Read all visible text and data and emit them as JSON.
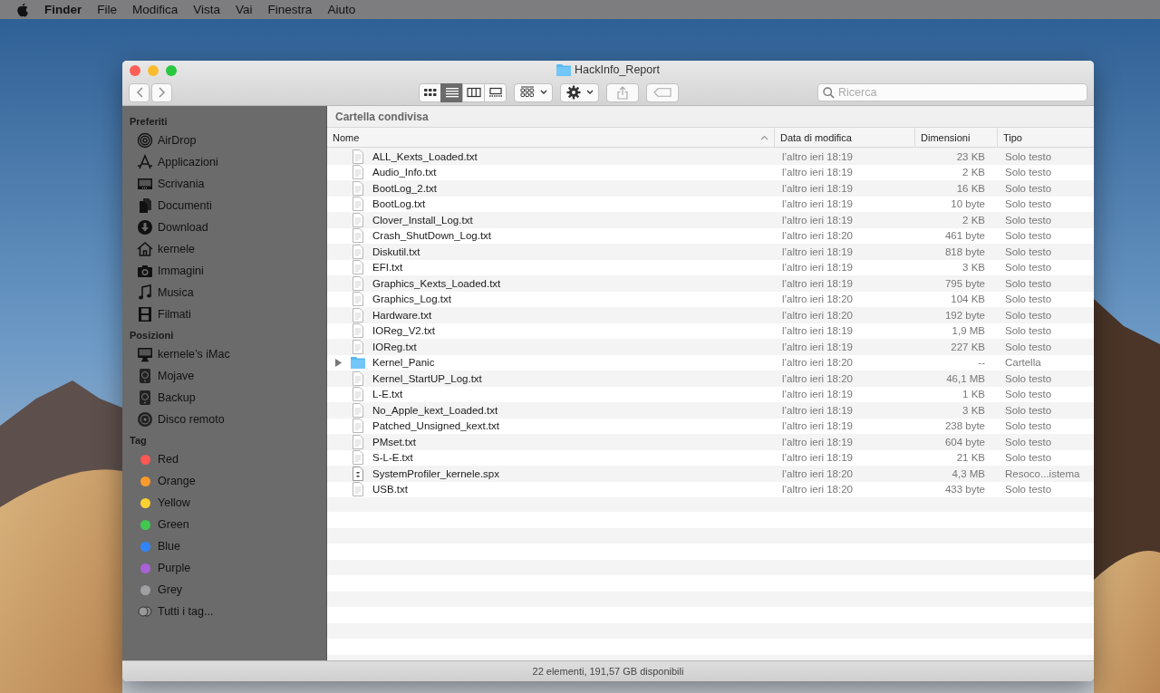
{
  "menu_bar": {
    "items": [
      {
        "label": "Finder",
        "kind": "app"
      },
      {
        "label": "File",
        "kind": "menu"
      },
      {
        "label": "Modifica",
        "kind": "menu"
      },
      {
        "label": "Vista",
        "kind": "menu"
      },
      {
        "label": "Vai",
        "kind": "menu"
      },
      {
        "label": "Finestra",
        "kind": "menu"
      },
      {
        "label": "Aiuto",
        "kind": "menu"
      }
    ]
  },
  "window": {
    "title": "HackInfo_Report"
  },
  "toolbar": {
    "view_buttons": [
      {
        "selected": false
      },
      {
        "selected": true
      },
      {
        "selected": false
      },
      {
        "selected": false
      }
    ],
    "search": {
      "placeholder": "Ricerca"
    }
  },
  "path_bar": "Cartella condivisa",
  "sidebar": {
    "sections": [
      {
        "title": "Preferiti",
        "items": [
          {
            "label": "AirDrop",
            "kind": "place"
          },
          {
            "label": "Applicazioni",
            "kind": "place"
          },
          {
            "label": "Scrivania",
            "kind": "place"
          },
          {
            "label": "Documenti",
            "kind": "place"
          },
          {
            "label": "Download",
            "kind": "place"
          },
          {
            "label": "kernele",
            "kind": "place"
          },
          {
            "label": "Immagini",
            "kind": "place"
          },
          {
            "label": "Musica",
            "kind": "place"
          },
          {
            "label": "Filmati",
            "kind": "place"
          }
        ]
      },
      {
        "title": "Posizioni",
        "items": [
          {
            "label": "kernele’s iMac",
            "kind": "place"
          },
          {
            "label": "Mojave",
            "kind": "place"
          },
          {
            "label": "Backup",
            "kind": "place"
          },
          {
            "label": "Disco remoto",
            "kind": "place"
          }
        ]
      },
      {
        "title": "Tag",
        "items": [
          {
            "label": "Red",
            "kind": "tag",
            "color": "#fc5753"
          },
          {
            "label": "Orange",
            "kind": "tag",
            "color": "#fd9a2d"
          },
          {
            "label": "Yellow",
            "kind": "tag",
            "color": "#fdd130"
          },
          {
            "label": "Green",
            "kind": "tag",
            "color": "#3fc94f"
          },
          {
            "label": "Blue",
            "kind": "tag",
            "color": "#2f85fc"
          },
          {
            "label": "Purple",
            "kind": "tag",
            "color": "#a961d6"
          },
          {
            "label": "Grey",
            "kind": "tag",
            "color": "#a0a0a4"
          },
          {
            "label": "Tutti i tag...",
            "kind": "all-tags"
          }
        ]
      }
    ]
  },
  "table": {
    "columns": [
      {
        "label": "Nome",
        "sorted": true
      },
      {
        "label": "Data di modifica",
        "sorted": false
      },
      {
        "label": "Dimensioni",
        "sorted": false
      },
      {
        "label": "Tipo",
        "sorted": false
      }
    ],
    "rows": [
      {
        "name": "ALL_Kexts_Loaded.txt",
        "date": "l’altro ieri 18:19",
        "size": "23 KB",
        "type": "Solo testo",
        "kind": "text"
      },
      {
        "name": "Audio_Info.txt",
        "date": "l’altro ieri 18:19",
        "size": "2 KB",
        "type": "Solo testo",
        "kind": "text"
      },
      {
        "name": "BootLog_2.txt",
        "date": "l’altro ieri 18:19",
        "size": "16 KB",
        "type": "Solo testo",
        "kind": "text"
      },
      {
        "name": "BootLog.txt",
        "date": "l’altro ieri 18:19",
        "size": "10 byte",
        "type": "Solo testo",
        "kind": "text"
      },
      {
        "name": "Clover_Install_Log.txt",
        "date": "l’altro ieri 18:19",
        "size": "2 KB",
        "type": "Solo testo",
        "kind": "text"
      },
      {
        "name": "Crash_ShutDown_Log.txt",
        "date": "l’altro ieri 18:20",
        "size": "461 byte",
        "type": "Solo testo",
        "kind": "text"
      },
      {
        "name": "Diskutil.txt",
        "date": "l’altro ieri 18:19",
        "size": "818 byte",
        "type": "Solo testo",
        "kind": "text"
      },
      {
        "name": "EFI.txt",
        "date": "l’altro ieri 18:19",
        "size": "3 KB",
        "type": "Solo testo",
        "kind": "text"
      },
      {
        "name": "Graphics_Kexts_Loaded.txt",
        "date": "l’altro ieri 18:19",
        "size": "795 byte",
        "type": "Solo testo",
        "kind": "text"
      },
      {
        "name": "Graphics_Log.txt",
        "date": "l’altro ieri 18:20",
        "size": "104 KB",
        "type": "Solo testo",
        "kind": "text"
      },
      {
        "name": "Hardware.txt",
        "date": "l’altro ieri 18:20",
        "size": "192 byte",
        "type": "Solo testo",
        "kind": "text"
      },
      {
        "name": "IOReg_V2.txt",
        "date": "l’altro ieri 18:19",
        "size": "1,9 MB",
        "type": "Solo testo",
        "kind": "text"
      },
      {
        "name": "IOReg.txt",
        "date": "l’altro ieri 18:19",
        "size": "227 KB",
        "type": "Solo testo",
        "kind": "text"
      },
      {
        "name": "Kernel_Panic",
        "date": "l’altro ieri 18:20",
        "size": "--",
        "type": "Cartella",
        "kind": "folder",
        "expanded": false
      },
      {
        "name": "Kernel_StartUP_Log.txt",
        "date": "l’altro ieri 18:20",
        "size": "46,1 MB",
        "type": "Solo testo",
        "kind": "text"
      },
      {
        "name": "L-E.txt",
        "date": "l’altro ieri 18:19",
        "size": "1 KB",
        "type": "Solo testo",
        "kind": "text"
      },
      {
        "name": "No_Apple_kext_Loaded.txt",
        "date": "l’altro ieri 18:19",
        "size": "3 KB",
        "type": "Solo testo",
        "kind": "text"
      },
      {
        "name": "Patched_Unsigned_kext.txt",
        "date": "l’altro ieri 18:19",
        "size": "238 byte",
        "type": "Solo testo",
        "kind": "text"
      },
      {
        "name": "PMset.txt",
        "date": "l’altro ieri 18:19",
        "size": "604 byte",
        "type": "Solo testo",
        "kind": "text"
      },
      {
        "name": "S-L-E.txt",
        "date": "l’altro ieri 18:19",
        "size": "21 KB",
        "type": "Solo testo",
        "kind": "text"
      },
      {
        "name": "SystemProfiler_kernele.spx",
        "date": "l’altro ieri 18:20",
        "size": "4,3 MB",
        "type": "Resoco...istema",
        "kind": "report"
      },
      {
        "name": "USB.txt",
        "date": "l’altro ieri 18:20",
        "size": "433 byte",
        "type": "Solo testo",
        "kind": "text"
      }
    ]
  },
  "status_bar": "22 elementi, 191,57 GB disponibili"
}
